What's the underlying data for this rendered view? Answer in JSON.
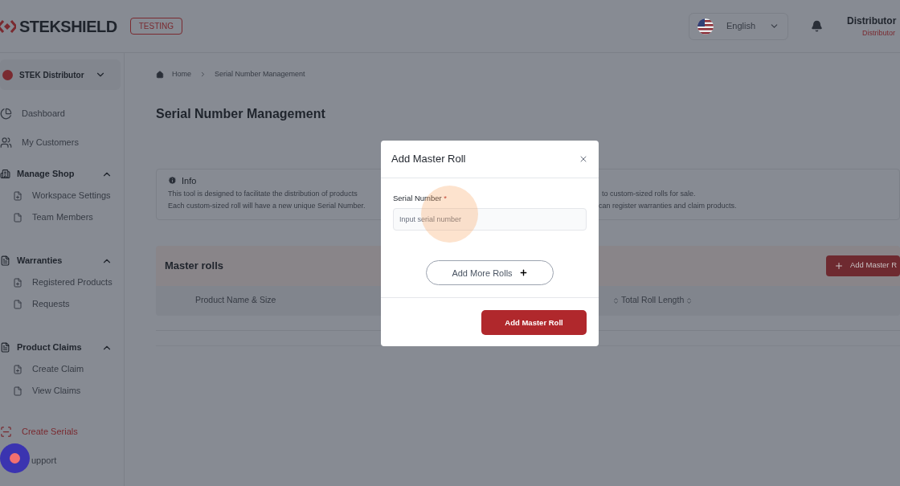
{
  "header": {
    "logo": "STEKSHIELD",
    "env_badge": "TESTING",
    "language": "English",
    "user_name": "Distributor",
    "user_role": "Distributor"
  },
  "sidebar": {
    "account": "STEK Distributor",
    "items": [
      {
        "kind": "link",
        "label": "Dashboard",
        "selected": false
      },
      {
        "kind": "link",
        "label": "My Customers",
        "selected": false
      },
      {
        "kind": "group",
        "label": "Manage Shop",
        "expanded": true,
        "children": [
          {
            "label": "Workspace Settings",
            "selected": false
          },
          {
            "label": "Team Members",
            "selected": false
          }
        ]
      },
      {
        "kind": "group",
        "label": "Warranties",
        "expanded": true,
        "children": [
          {
            "label": "Registered Products",
            "selected": false
          },
          {
            "label": "Requests",
            "selected": false
          }
        ]
      },
      {
        "kind": "group",
        "label": "Product Claims",
        "expanded": true,
        "children": [
          {
            "label": "Create Claim",
            "selected": false
          },
          {
            "label": "View Claims",
            "selected": false
          }
        ]
      },
      {
        "kind": "link",
        "label": "Create Serials",
        "selected": true
      },
      {
        "kind": "link",
        "label": "upport",
        "selected": false
      }
    ]
  },
  "breadcrumb": [
    "Home",
    "Serial Number Management"
  ],
  "page_title": "Serial Number Management",
  "info": {
    "title": "Info",
    "lines": [
      {
        "left": "This tool is designed to facilitate the distribution of products",
        "right": "to custom-sized rolls for sale."
      },
      {
        "left": "Each custom-sized roll will have a new unique Serial Number.",
        "right": "can register warranties and claim products."
      }
    ]
  },
  "master_rolls": {
    "title": "Master rolls",
    "add_button": "Add Master R",
    "columns": [
      "Product Name & Size",
      "Total Roll Length"
    ]
  },
  "modal": {
    "title": "Add Master Roll",
    "field_label": "Serial Number",
    "required_mark": "*",
    "placeholder": "Input serial number",
    "add_more": "Add More Rolls",
    "submit": "Add Master Roll"
  }
}
